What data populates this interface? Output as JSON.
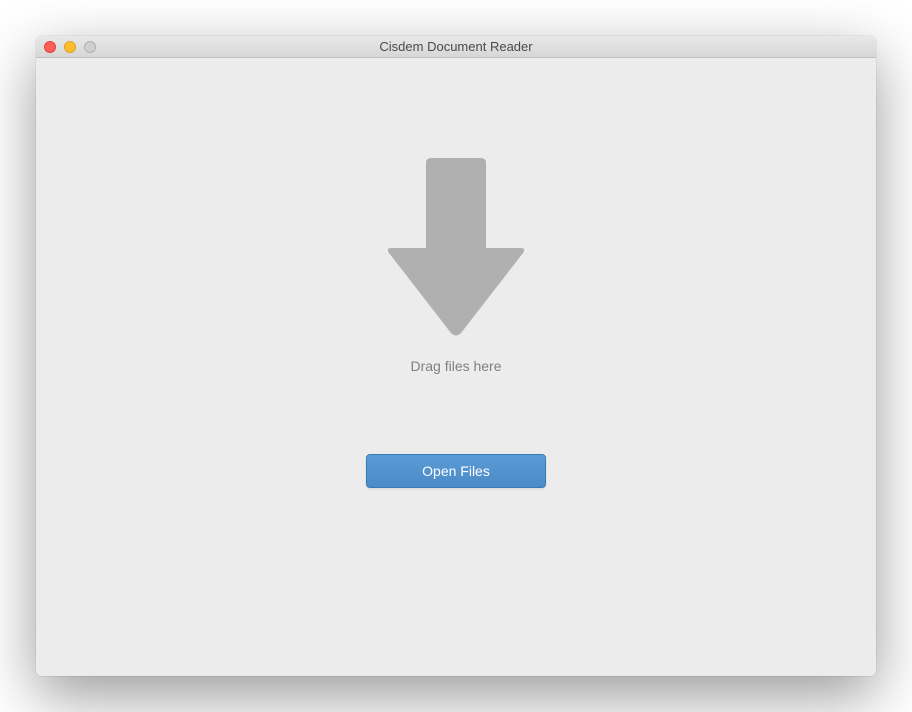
{
  "titlebar": {
    "title": "Cisdem Document Reader"
  },
  "content": {
    "drag_text": "Drag files here",
    "open_button_label": "Open Files"
  }
}
